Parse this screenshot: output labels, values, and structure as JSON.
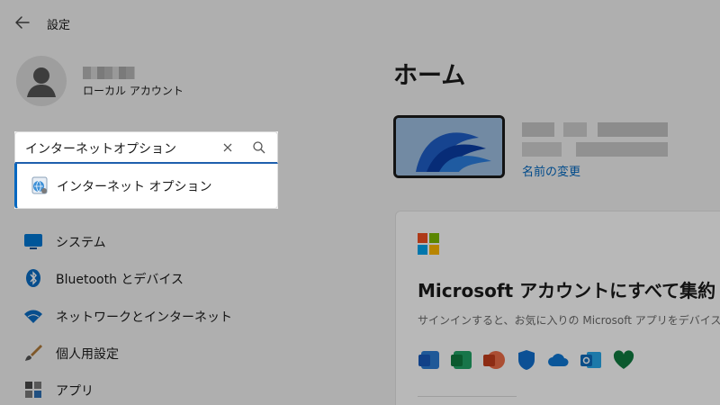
{
  "window": {
    "title": "設定"
  },
  "account": {
    "type": "ローカル アカウント"
  },
  "search": {
    "value": "インターネットオプション",
    "suggestion": "インターネット オプション"
  },
  "nav": {
    "items": [
      {
        "label": "システム",
        "icon": "monitor-icon"
      },
      {
        "label": "Bluetooth とデバイス",
        "icon": "bluetooth-icon"
      },
      {
        "label": "ネットワークとインターネット",
        "icon": "wifi-icon"
      },
      {
        "label": "個人用設定",
        "icon": "brush-icon"
      },
      {
        "label": "アプリ",
        "icon": "apps-icon"
      }
    ]
  },
  "home": {
    "title": "ホーム",
    "rename_link": "名前の変更",
    "card": {
      "title": "Microsoft アカウントにすべて集約",
      "description": "サインインすると、お気に入りの Microsoft アプリをデバイスに"
    },
    "app_icons": [
      "word-icon",
      "excel-icon",
      "powerpoint-icon",
      "defender-icon",
      "onedrive-icon",
      "outlook-icon",
      "family-icon"
    ]
  },
  "colors": {
    "accent": "#0067c0",
    "overlay": "rgba(0,0,0,0.28)"
  }
}
